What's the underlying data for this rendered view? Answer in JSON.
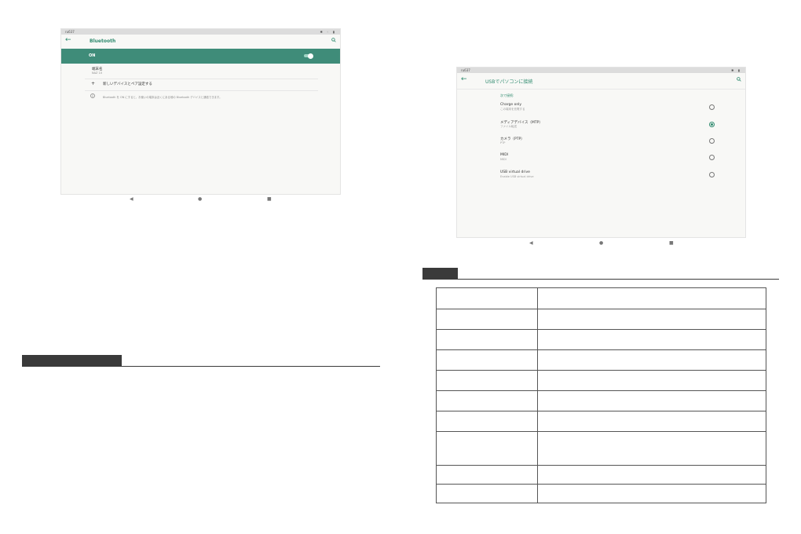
{
  "bluetooth_screen": {
    "status_time": "ru637",
    "status_icons": "✱ ◦ ▮",
    "back_icon": "arrow-left-icon",
    "title": "Bluetooth",
    "on_label": "ON",
    "device_name_label": "端末名",
    "device_name_value": "NAZ 10",
    "pair_new_label": "新しいデバイスとペア設定する",
    "info_text": "Bluetooth を ON にすると、お使いの端末は近くにある他の Bluetooth デバイスと通信できます。",
    "nav": [
      "◀",
      "●",
      "■"
    ]
  },
  "usb_screen": {
    "status_time": "ru637",
    "status_icons": "✱ ▮",
    "title": "USBでパソコンに接続",
    "section_label": "次で接続:",
    "options": [
      {
        "title": "Charge only",
        "sub": "この端末を充電する",
        "selected": false
      },
      {
        "title": "メディアデバイス（MTP）",
        "sub": "ファイル転送",
        "selected": true
      },
      {
        "title": "カメラ（PTP）",
        "sub": "PTP",
        "selected": false
      },
      {
        "title": "MIDI",
        "sub": "MIDI",
        "selected": false
      },
      {
        "title": "USB virtual drive",
        "sub": "Enable USB virtual drive",
        "selected": false
      }
    ],
    "nav": [
      "◀",
      "●",
      "■"
    ]
  },
  "spec_table": {
    "rows": [
      [
        "",
        ""
      ],
      [
        "",
        ""
      ],
      [
        "",
        ""
      ],
      [
        "",
        ""
      ],
      [
        "",
        ""
      ],
      [
        "",
        ""
      ],
      [
        "",
        ""
      ],
      [
        "",
        ""
      ],
      [
        "",
        ""
      ],
      [
        "",
        ""
      ]
    ]
  },
  "colors": {
    "accent": "#2e8a6e",
    "on_bar": "#3f8c79",
    "heading_tab": "#3a3a3a"
  }
}
